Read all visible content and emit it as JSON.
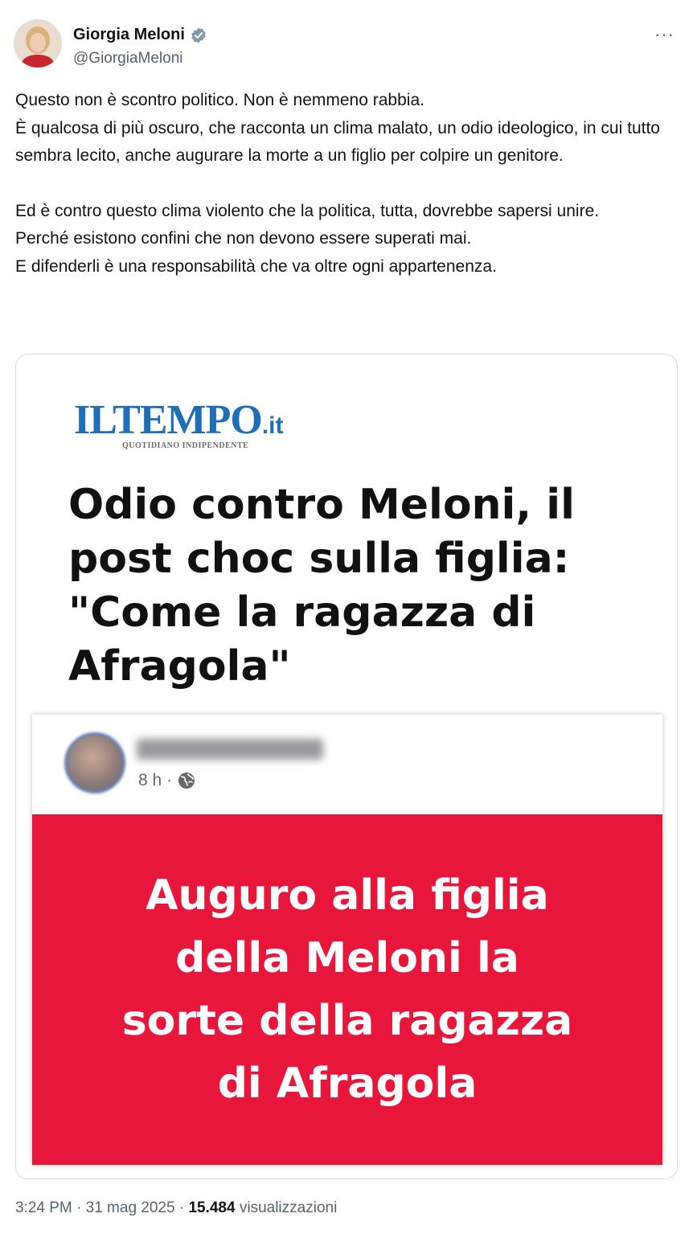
{
  "author": {
    "name": "Giorgia Meloni",
    "handle": "@GiorgiaMeloni",
    "more_label": "···"
  },
  "tweet": {
    "lines": [
      "Questo non è scontro politico. Non è nemmeno rabbia.",
      "È qualcosa di più oscuro, che racconta un clima malato, un odio ideologico, in cui tutto sembra lecito, anche augurare la morte a un figlio per colpire un genitore.",
      "Ed è contro questo clima violento che la politica, tutta, dovrebbe sapersi unire.",
      "Perché esistono confini che non devono essere superati mai.",
      "E difenderli è una responsabilità che va oltre ogni appartenenza."
    ]
  },
  "card": {
    "logo_main": "ILTEMPO",
    "logo_tld": ".it",
    "logo_sub": "QUOTIDIANO INDIPENDENTE",
    "headline_lines": [
      "Odio contro Meloni, il",
      "post choc sulla figlia:",
      "\"Come la ragazza di",
      "Afragola\""
    ],
    "post": {
      "time": "8 h ·",
      "message_lines": [
        "Auguro alla figlia",
        "della Meloni la",
        "sorte della ragazza",
        "di Afragola"
      ]
    }
  },
  "footer": {
    "time_date": "3:24 PM · 31 mag 2025 · ",
    "views_count": "15.484",
    "views_label": " visualizzazioni"
  },
  "colors": {
    "verified": "#829aab",
    "link_blue": "#1e6fb8",
    "alert_red": "#e9163b"
  }
}
